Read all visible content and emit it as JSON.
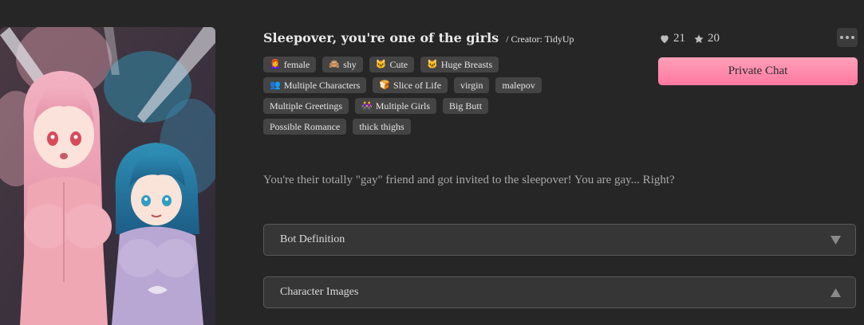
{
  "bot": {
    "title": "Sleepover, you're one of the girls",
    "creator": "/ Creator: TidyUp",
    "description": "You're their totally \"gay\" friend and got invited to the sleepover! You are gay... Right?"
  },
  "tags": [
    {
      "emoji": "👩‍🦰",
      "label": "female"
    },
    {
      "emoji": "🙈",
      "label": "shy"
    },
    {
      "emoji": "🐱",
      "label": "Cute"
    },
    {
      "emoji": "🐱",
      "label": "Huge Breasts"
    },
    {
      "emoji": "👥",
      "label": "Multiple Characters"
    },
    {
      "emoji": "🍞",
      "label": "Slice of Life"
    },
    {
      "emoji": "",
      "label": "virgin"
    },
    {
      "emoji": "",
      "label": "malepov"
    },
    {
      "emoji": "",
      "label": "Multiple Greetings"
    },
    {
      "emoji": "👭",
      "label": "Multiple Girls"
    },
    {
      "emoji": "",
      "label": "Big Butt"
    },
    {
      "emoji": "",
      "label": "Possible Romance"
    },
    {
      "emoji": "",
      "label": "thick thighs"
    }
  ],
  "stats": {
    "likes": "21",
    "stars": "20"
  },
  "actions": {
    "chat_label": "Private Chat"
  },
  "sections": {
    "definition_label": "Bot Definition",
    "images_label": "Character Images"
  },
  "colors": {
    "background": "#262626",
    "tag_bg": "#444444",
    "accent_pink": "#ff8aab"
  },
  "icons": {
    "likes": "heart-icon",
    "stars": "star-icon",
    "more": "more-dots-icon",
    "definition_toggle": "chevron-down-icon",
    "images_toggle": "chevron-up-icon"
  }
}
